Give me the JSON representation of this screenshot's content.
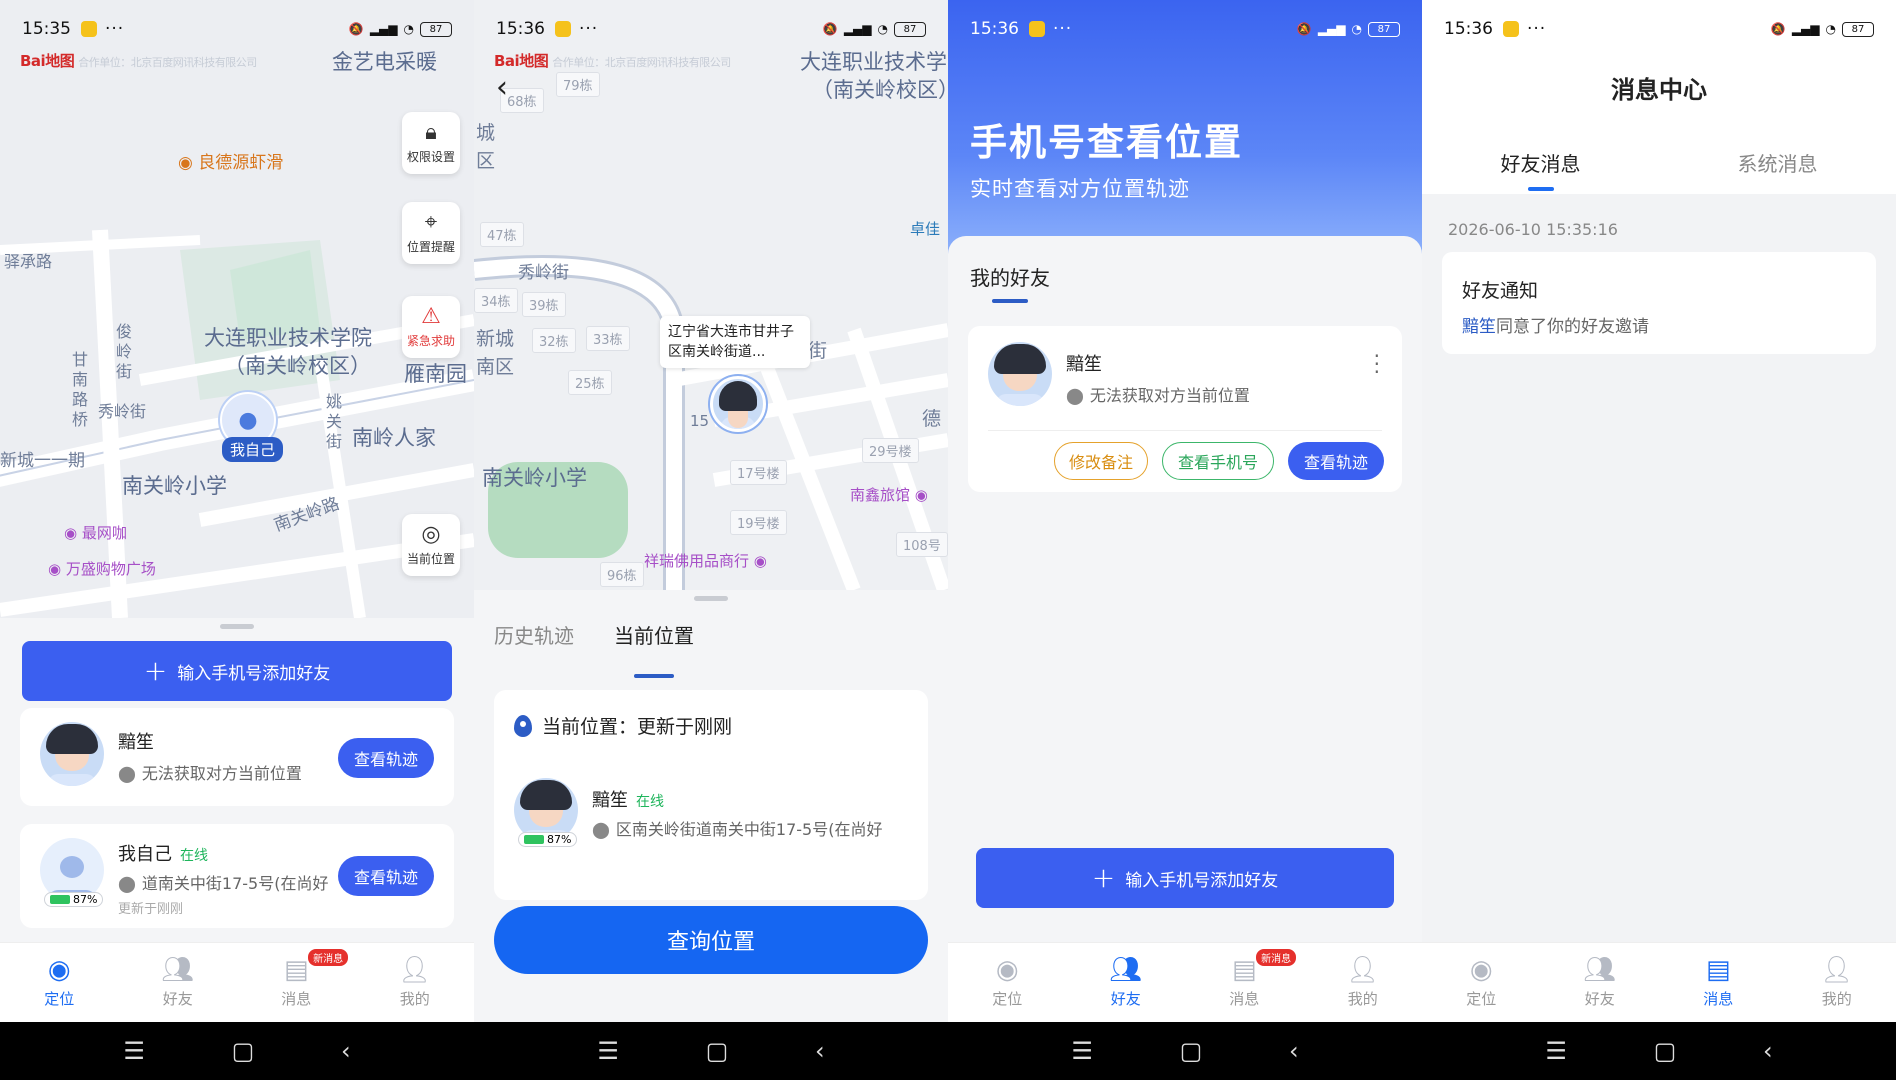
{
  "status": {
    "p1_time": "15:35",
    "p2_time": "15:36",
    "p3_time": "15:36",
    "p4_time": "15:36",
    "battery": "87"
  },
  "map1": {
    "logo": "Bai地图",
    "labels": {
      "jinyi": "金艺电采暖",
      "liangde": "良德源虾滑",
      "yichengroad": "驿承路",
      "school1": "大连职业技术学院",
      "school2": "（南关岭校区）",
      "junling": "俊岭街",
      "gannan": "甘南路桥",
      "xiuling": "秀岭街",
      "yaoguang": "姚关街",
      "nanling": "南岭人家",
      "yannan": "雁南园",
      "nanguanschool": "南关岭小学",
      "xincheng": "新城一一期",
      "nanguanroad": "南关岭路",
      "zuiwang": "最网咖",
      "wansheng": "万盛购物广场"
    },
    "buttons": {
      "permission": "权限设置",
      "reminder": "位置提醒",
      "sos": "紧急求助",
      "current": "当前位置"
    },
    "me_label": "我自己"
  },
  "sheet1": {
    "add_button": "输入手机号添加好友",
    "friend": {
      "name": "黯笙",
      "location": "无法获取对方当前位置",
      "button": "查看轨迹"
    },
    "self": {
      "name": "我自己",
      "online": "在线",
      "battery": "87%",
      "location": "道南关中街17-5号(在尚好",
      "updated": "更新于刚刚",
      "button": "查看轨迹"
    }
  },
  "tabs": {
    "locate": "定位",
    "friends": "好友",
    "messages": "消息",
    "mine": "我的",
    "badge": "新消息"
  },
  "map2": {
    "school1": "大连职业技术学",
    "school2": "（南关岭校区）",
    "b79": "79栋",
    "b68": "68栋",
    "b47": "47栋",
    "b34": "34栋",
    "b39": "39栋",
    "b32": "32栋",
    "b33": "33栋",
    "b25": "25栋",
    "b15": "15",
    "b96": "96栋",
    "l17": "17号楼",
    "l19": "19号楼",
    "l29": "29号楼",
    "l108": "108号",
    "xiuling": "秀岭街",
    "cheng": "城",
    "qu": "区",
    "xincheng": "新城",
    "nanqu": "南区",
    "nanguanschool": "南关岭小学",
    "nanxin": "南鑫旅馆",
    "xiangrui": "祥瑞佛用品商行",
    "zhuojia": "卓佳",
    "de": "德",
    "jie": "街",
    "callout": "辽宁省大连市甘井子区南关岭街道..."
  },
  "panel2": {
    "tab_history": "历史轨迹",
    "tab_current": "当前位置",
    "card_title": "当前位置：更新于刚刚",
    "name": "黯笙",
    "online": "在线",
    "battery": "87%",
    "address": "区南关岭街道南关中街17-5号(在尚好",
    "query_button": "查询位置"
  },
  "panel3": {
    "hero_title": "手机号查看位置",
    "hero_sub": "实时查看对方位置轨迹",
    "section": "我的好友",
    "name": "黯笙",
    "location": "无法获取对方当前位置",
    "btn_remark": "修改备注",
    "btn_phone": "查看手机号",
    "btn_track": "查看轨迹",
    "add_button": "输入手机号添加好友"
  },
  "panel4": {
    "title": "消息中心",
    "tab_friends": "好友消息",
    "tab_system": "系统消息",
    "date": "2026-06-10 15:35:16",
    "card_title": "好友通知",
    "card_name": "黯笙",
    "card_body": "同意了你的好友邀请"
  }
}
